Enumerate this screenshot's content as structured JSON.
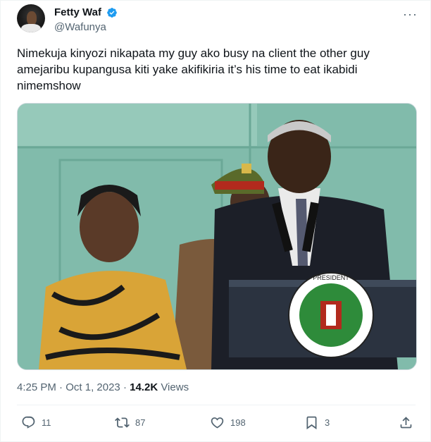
{
  "author": {
    "name": "Fetty Waf",
    "handle": "@Wafunya",
    "verified": true,
    "badge_color": "#1d9bf0"
  },
  "tweet": {
    "text": "Nimekuja kinyozi nikapata my guy ako busy na client the other guy amejaribu kupangusa kiti yake akifikiria it’s his time to eat ikabidi nimemshow",
    "time": "4:25 PM",
    "date": "Oct 1, 2023",
    "views_count": "14.2K",
    "views_label": "Views"
  },
  "photo": {
    "description_icon": "press-conference-photo",
    "seal_text": "PRESIDENT · REPUBLIC OF KENYA"
  },
  "actions": {
    "replies": "11",
    "reposts": "87",
    "likes": "198",
    "bookmarks": "3"
  },
  "colors": {
    "text": "#0f1419",
    "secondary": "#536471",
    "repost_green": "#00ba7c"
  }
}
